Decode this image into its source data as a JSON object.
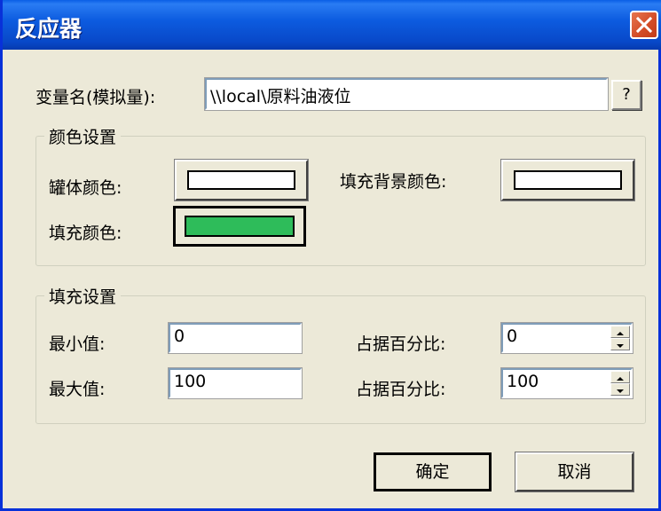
{
  "window": {
    "title": "反应器"
  },
  "variable": {
    "label": "变量名(模拟量):",
    "value": "\\\\local\\原料油液位",
    "browse_label": "?"
  },
  "color_group": {
    "title": "颜色设置",
    "tank_color_label": "罐体颜色:",
    "fill_bg_color_label": "填充背景颜色:",
    "fill_color_label": "填充颜色:",
    "tank_color": "#ffffff",
    "fill_bg_color": "#ffffff",
    "fill_color": "#2ebc5a"
  },
  "fill_group": {
    "title": "填充设置",
    "min_label": "最小值:",
    "min_value": "0",
    "max_label": "最大值:",
    "max_value": "100",
    "min_percent_label": "占据百分比:",
    "min_percent_value": "0",
    "max_percent_label": "占据百分比:",
    "max_percent_value": "100"
  },
  "buttons": {
    "ok": "确定",
    "cancel": "取消"
  }
}
